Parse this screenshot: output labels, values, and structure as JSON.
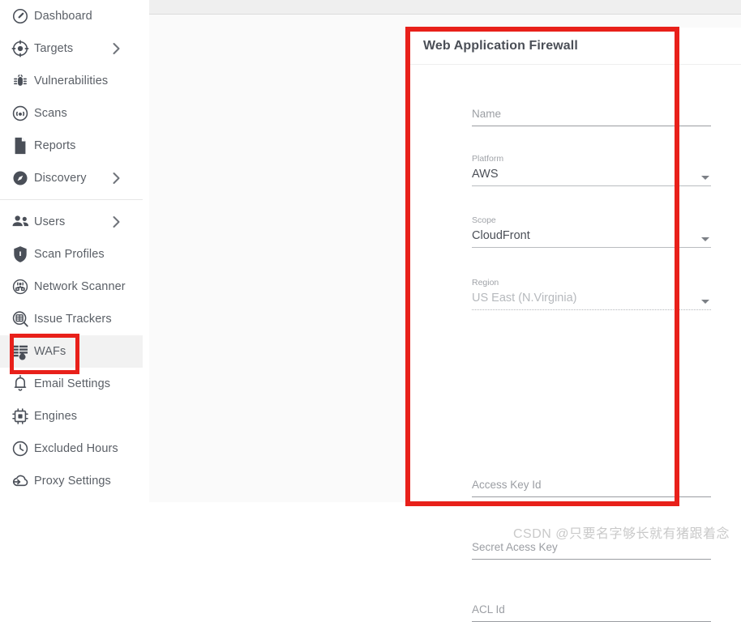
{
  "sidebar": {
    "groups": [
      {
        "items": [
          {
            "label": "Dashboard",
            "icon": "gauge-icon",
            "chevron": false,
            "active": false
          },
          {
            "label": "Targets",
            "icon": "target-icon",
            "chevron": true,
            "active": false
          },
          {
            "label": "Vulnerabilities",
            "icon": "bug-icon",
            "chevron": false,
            "active": false
          },
          {
            "label": "Scans",
            "icon": "radar-icon",
            "chevron": false,
            "active": false
          },
          {
            "label": "Reports",
            "icon": "document-icon",
            "chevron": false,
            "active": false
          },
          {
            "label": "Discovery",
            "icon": "compass-icon",
            "chevron": true,
            "active": false
          }
        ]
      },
      {
        "items": [
          {
            "label": "Users",
            "icon": "users-icon",
            "chevron": true,
            "active": false
          },
          {
            "label": "Scan Profiles",
            "icon": "shield-icon",
            "chevron": false,
            "active": false
          },
          {
            "label": "Network Scanner",
            "icon": "network-scanner-icon",
            "chevron": false,
            "active": false
          },
          {
            "label": "Issue Trackers",
            "icon": "issue-tracker-icon",
            "chevron": false,
            "active": false
          },
          {
            "label": "WAFs",
            "icon": "waf-icon",
            "chevron": false,
            "active": true
          },
          {
            "label": "Email Settings",
            "icon": "bell-icon",
            "chevron": false,
            "active": false
          },
          {
            "label": "Engines",
            "icon": "chip-icon",
            "chevron": false,
            "active": false
          },
          {
            "label": "Excluded Hours",
            "icon": "clock-icon",
            "chevron": false,
            "active": false
          },
          {
            "label": "Proxy Settings",
            "icon": "proxy-cloud-icon",
            "chevron": false,
            "active": false
          }
        ]
      }
    ]
  },
  "card": {
    "title": "Web Application Firewall",
    "fields": [
      {
        "key": "name",
        "label": "Name",
        "value": "",
        "type": "text",
        "state": "empty"
      },
      {
        "key": "platform",
        "label": "Platform",
        "value": "AWS",
        "type": "select",
        "state": "filled"
      },
      {
        "key": "scope",
        "label": "Scope",
        "value": "CloudFront",
        "type": "select",
        "state": "filled"
      },
      {
        "key": "region",
        "label": "Region",
        "value": "US East (N.Virginia)",
        "type": "select",
        "state": "disabled"
      },
      {
        "key": "access_key",
        "label": "Access Key Id",
        "value": "",
        "type": "text",
        "state": "empty"
      },
      {
        "key": "secret_key",
        "label": "Secret Acess Key",
        "value": "",
        "type": "text",
        "state": "empty"
      },
      {
        "key": "acl_id",
        "label": "ACL Id",
        "value": "",
        "type": "text",
        "state": "empty"
      }
    ]
  },
  "annotations": {
    "accent_color": "#e8201a",
    "card_box_name": "web-application-firewall-form",
    "sidebar_box_name": "wafs-nav-item"
  },
  "watermark": {
    "text": "CSDN @只要名字够长就有猪跟着念"
  }
}
